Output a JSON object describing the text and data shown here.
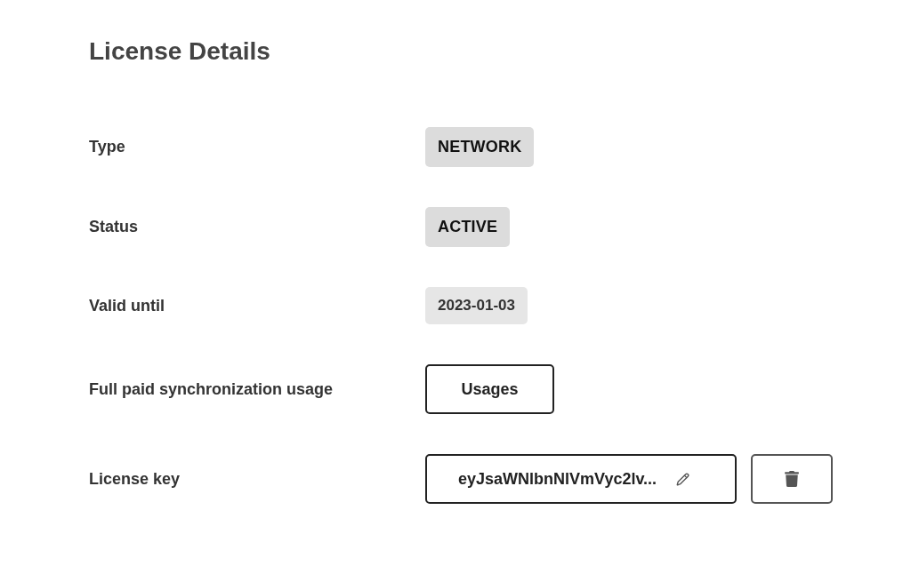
{
  "title": "License Details",
  "rows": [
    {
      "label": "Type",
      "kind": "badge",
      "value": "NETWORK"
    },
    {
      "label": "Status",
      "kind": "badge",
      "value": "ACTIVE"
    },
    {
      "label": "Valid until",
      "kind": "tag",
      "value": "2023-01-03"
    },
    {
      "label": "Full paid synchronization usage",
      "kind": "button",
      "value": "Usages"
    },
    {
      "label": "License key",
      "kind": "key",
      "value": "eyJsaWNlbnNlVmVyc2lv...",
      "deletable": true
    }
  ]
}
